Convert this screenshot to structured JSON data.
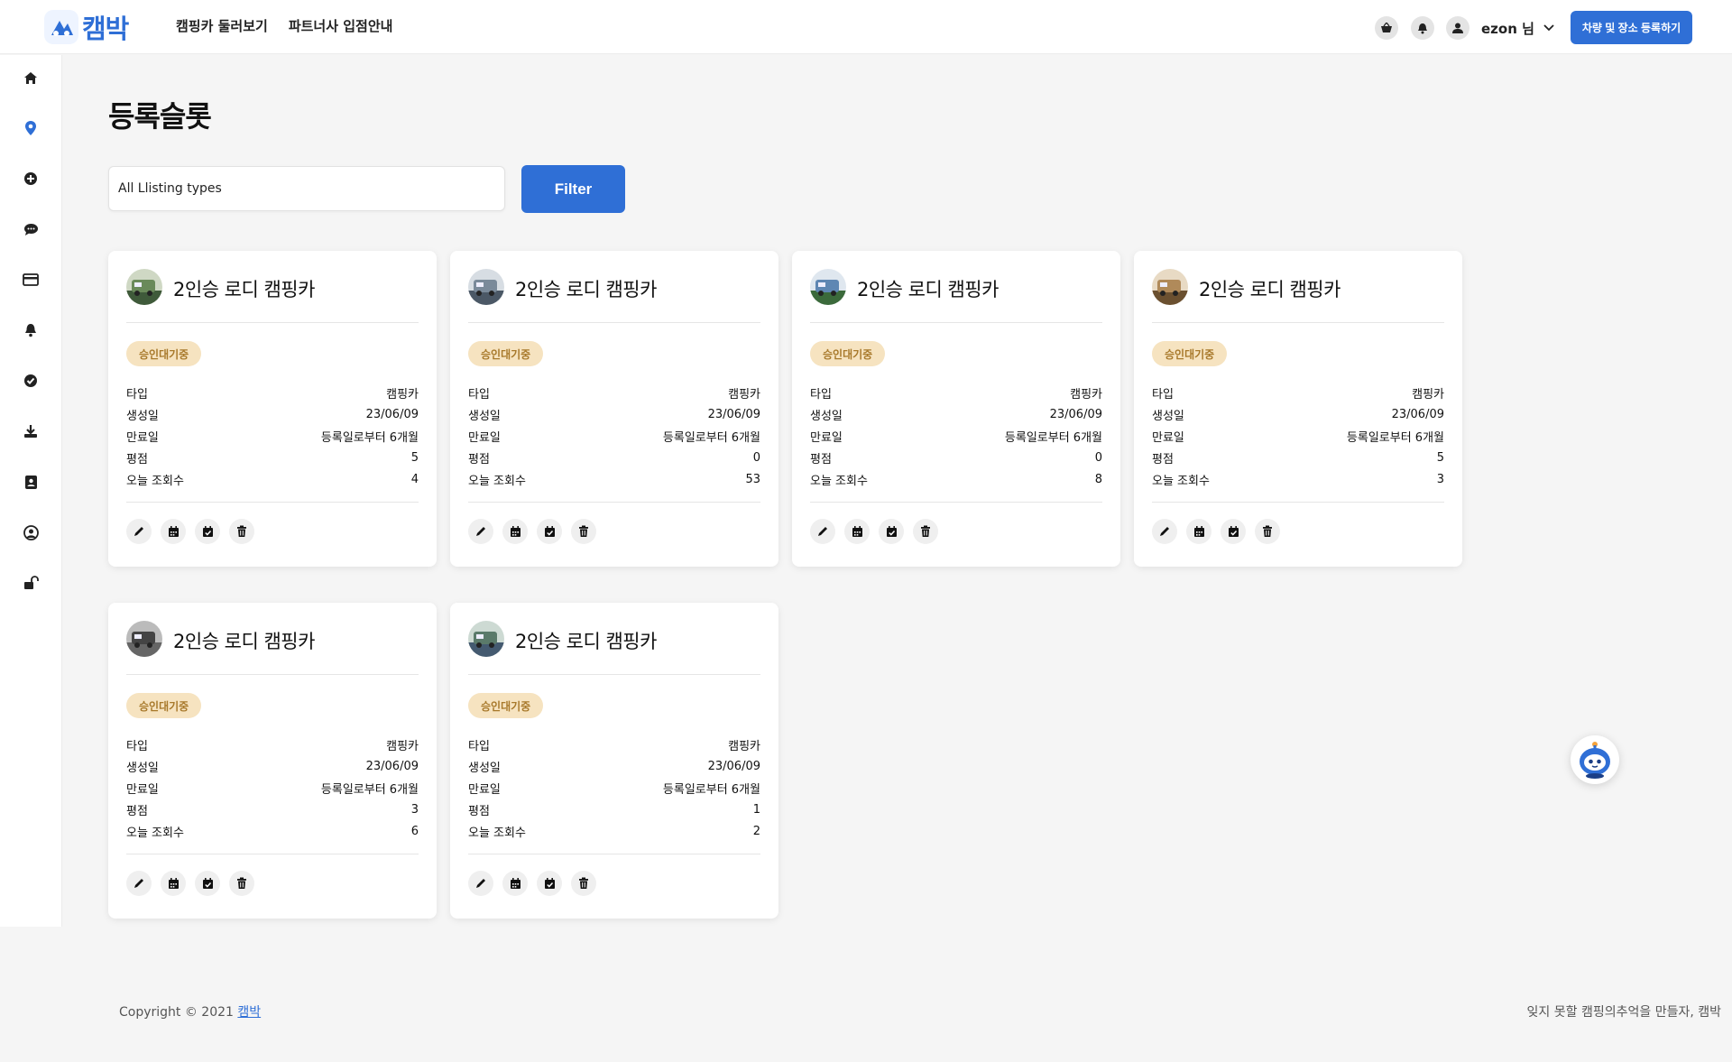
{
  "header": {
    "logo_text": "캠박",
    "nav": [
      "캠핑카 둘러보기",
      "파트너사 입점안내"
    ],
    "user_name": "ezon 님",
    "cta_label": "차량 및 장소 등록하기"
  },
  "sidebar": {
    "items": [
      "home-icon",
      "map-pin-icon",
      "add-circle-icon",
      "chat-icon",
      "credit-card-icon",
      "bell-icon",
      "check-circle-icon",
      "download-icon",
      "address-book-icon",
      "user-circle-icon",
      "unlock-icon"
    ],
    "active_index": 1
  },
  "main": {
    "page_title": "등록슬롯",
    "filter": {
      "selected": "All Llisting types",
      "button_label": "Filter"
    }
  },
  "row_labels": {
    "type": "타입",
    "created": "생성일",
    "expires": "만료일",
    "rating": "평점",
    "views": "오늘 조회수"
  },
  "cards": [
    {
      "title": "2인승 로디 캠핑카",
      "badge": "승인대기중",
      "type": "캠핑카",
      "created": "23/06/09",
      "expires": "등록일로부터 6개월",
      "rating": "5",
      "views": "4"
    },
    {
      "title": "2인승 로디 캠핑카",
      "badge": "승인대기중",
      "type": "캠핑카",
      "created": "23/06/09",
      "expires": "등록일로부터 6개월",
      "rating": "0",
      "views": "53"
    },
    {
      "title": "2인승 로디 캠핑카",
      "badge": "승인대기중",
      "type": "캠핑카",
      "created": "23/06/09",
      "expires": "등록일로부터 6개월",
      "rating": "0",
      "views": "8"
    },
    {
      "title": "2인승 로디 캠핑카",
      "badge": "승인대기중",
      "type": "캠핑카",
      "created": "23/06/09",
      "expires": "등록일로부터 6개월",
      "rating": "5",
      "views": "3"
    },
    {
      "title": "2인승 로디 캠핑카",
      "badge": "승인대기중",
      "type": "캠핑카",
      "created": "23/06/09",
      "expires": "등록일로부터 6개월",
      "rating": "3",
      "views": "6"
    },
    {
      "title": "2인승 로디 캠핑카",
      "badge": "승인대기중",
      "type": "캠핑카",
      "created": "23/06/09",
      "expires": "등록일로부터 6개월",
      "rating": "1",
      "views": "2"
    }
  ],
  "footer": {
    "copyright": "Copyright © 2021",
    "brand_link": "캠박",
    "tagline": "잊지 못할 캠핑의추억을 만들자, 캠박"
  },
  "colors": {
    "brand": "#2f6fd6",
    "badge_bg": "#f6e3c0",
    "badge_text": "#a8792b"
  }
}
